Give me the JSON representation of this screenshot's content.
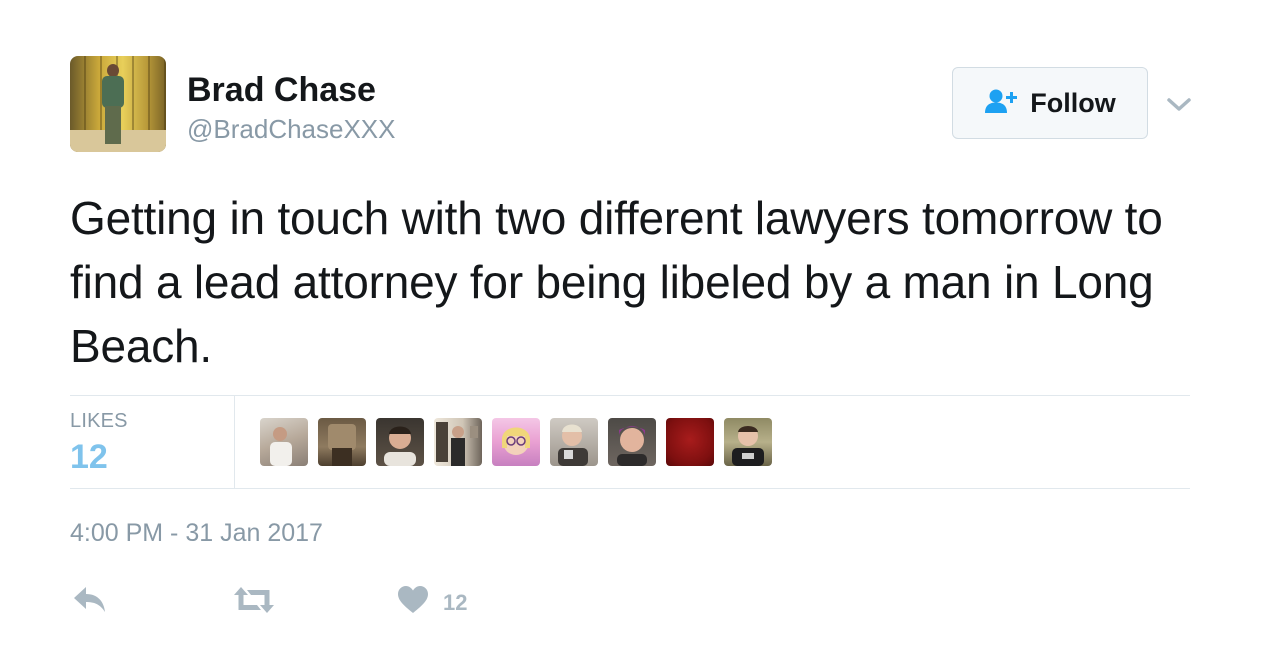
{
  "author": {
    "name": "Brad Chase",
    "handle": "@BradChaseXXX",
    "avatar_icon": "profile-photo"
  },
  "follow_button": {
    "label": "Follow",
    "icon": "add-user-icon",
    "icon_color": "#1da1f2"
  },
  "more_menu_icon": "chevron-down-icon",
  "tweet": {
    "text": "Getting in touch with two different lawyers tomorrow to find a lead attorney for being libeled by a man in Long Beach."
  },
  "stats": {
    "likes_label": "LIKES",
    "likes_count": "12",
    "likes_color": "#7fc3ec"
  },
  "likers": [
    {
      "name": "liker-1"
    },
    {
      "name": "liker-2"
    },
    {
      "name": "liker-3"
    },
    {
      "name": "liker-4"
    },
    {
      "name": "liker-5"
    },
    {
      "name": "liker-6"
    },
    {
      "name": "liker-7"
    },
    {
      "name": "liker-8"
    },
    {
      "name": "liker-9"
    }
  ],
  "timestamp": "4:00 PM - 31 Jan 2017",
  "actions": {
    "reply_icon": "reply-icon",
    "retweet_icon": "retweet-icon",
    "like_icon": "heart-icon",
    "like_count": "12",
    "icon_color": "#aab8c2"
  }
}
